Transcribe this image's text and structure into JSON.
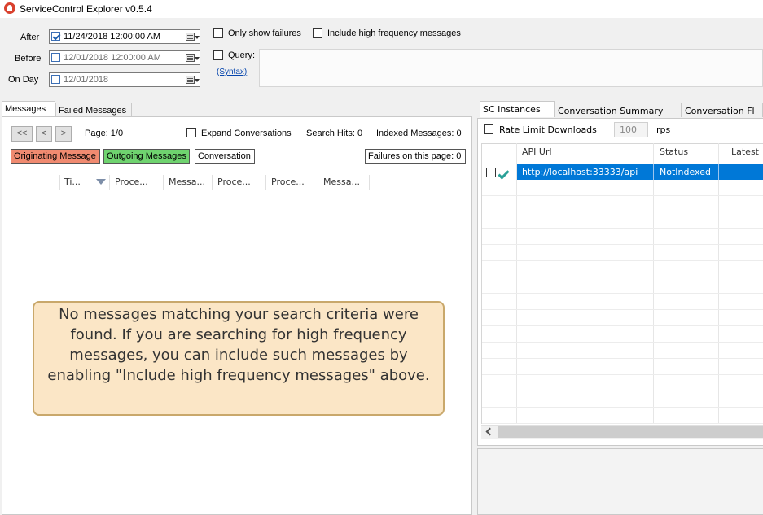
{
  "window": {
    "title": "ServiceControl Explorer v0.5.4"
  },
  "filters": {
    "after_label": "After",
    "after_value": "11/24/2018 12:00:00 AM",
    "before_label": "Before",
    "before_value": "12/01/2018 12:00:00 AM",
    "onday_label": "On Day",
    "onday_value": "12/01/2018",
    "only_failures_label": "Only show failures",
    "high_freq_label": "Include high frequency messages",
    "query_label": "Query:",
    "syntax_link": "(Syntax)"
  },
  "left_tabs": [
    "Messages",
    "Failed Messages"
  ],
  "pager": {
    "first": "<<",
    "prev": "<",
    "next": ">",
    "page_text": "Page: 1/0",
    "expand_label": "Expand Conversations",
    "search_hits": "Search Hits: 0",
    "indexed": "Indexed Messages: 0"
  },
  "legend": {
    "originating": "Originating Message",
    "outgoing": "Outgoing Messages",
    "conversation": "Conversation",
    "failures": "Failures on this page: 0"
  },
  "columns": [
    "Ti...",
    "Proce...",
    "Messa...",
    "Proce...",
    "Proce...",
    "Messa..."
  ],
  "empty_message": "No messages matching your search criteria were found. If you are searching for high frequency messages, you can include such messages by enabling \"Include high frequency messages\" above.",
  "right_tabs": [
    "SC Instances",
    "Conversation Summary",
    "Conversation Fl"
  ],
  "rate_limit": {
    "label": "Rate Limit Downloads",
    "value": "100",
    "unit": "rps"
  },
  "instances_grid": {
    "headers": [
      "API Url",
      "Status",
      "Latest"
    ],
    "rows": [
      {
        "url": "http://localhost:33333/api",
        "status": "NotIndexed"
      }
    ]
  },
  "colors": {
    "originating": "#f08a70",
    "outgoing": "#6fd36f",
    "selected_row": "#0078d7",
    "accent_check": "#2aa198"
  },
  "icons": {
    "app": "app-icon",
    "calendar": "calendar-icon",
    "check": "checkmark-icon"
  }
}
